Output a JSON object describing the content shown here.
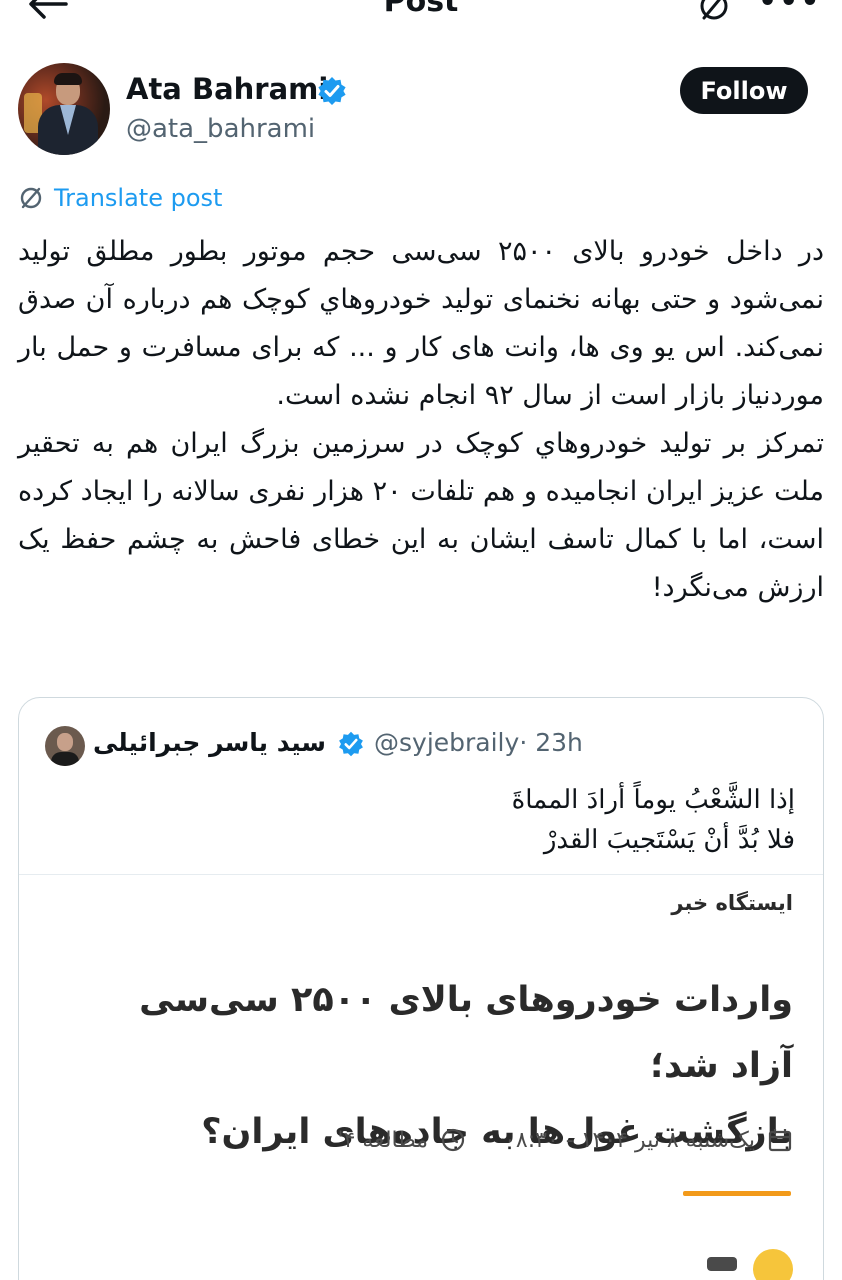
{
  "topbar": {
    "title": "Post",
    "icons": [
      "back-arrow-icon",
      "translate-icon",
      "more-icon"
    ]
  },
  "author": {
    "name": "Ata Bahrami",
    "handle": "@ata_bahrami",
    "verified": true,
    "follow_label": "Follow"
  },
  "translate": {
    "label": "Translate post",
    "icon": "translate-icon"
  },
  "post": {
    "paragraphs": [
      "در داخل خودرو بالای ۲۵۰۰ سی‌سی حجم موتور بطور مطلق تولید نمی‌شود و حتی بهانه نخنمای تولید خودروهاي کوچک هم درباره آن صدق نمی‌کند. اس یو وی ها، وانت های کار و ... که برای مسافرت و حمل بار موردنیاز بازار است از سال ۹۲ انجام نشده است.",
      "تمرکز بر تولید خودروهاي کوچک در سرزمین بزرگ ایران هم به تحقیر ملت عزیز ایران انجامیده و هم تلفات ۲۰ هزار نفری سالانه را ایجاد کرده است، اما با کمال تاسف ایشان به این خطای فاحش به چشم حفظ یک ارزش می‌نگرد!"
    ]
  },
  "quote": {
    "name": "سید یاسر جبرائیلی",
    "handle": "@syjebraily",
    "time": "· 23h",
    "verified": true,
    "lines": [
      "إذا الشَّعْبُ يوماً أرادَ المماةَ",
      "فلا بُدَّ أنْ يَسْتَجيبَ القدرْ"
    ],
    "news": {
      "source": "ایستگاه خبر",
      "headline_lines": [
        "واردات خودروهای بالای ۲۵۰۰ سی‌سی آزاد شد؛",
        "بازگشت غول‌ها به جاده‌های ایران؟"
      ],
      "date": "یک‌شنبه ۸ تیر ۱۴۰۴ - ۰۸:۳۰",
      "read_time": "مطالعه ۴'",
      "accent": "#f29a1a"
    }
  },
  "colors": {
    "link": "#1d9bf0",
    "verified": "#1d9bf0",
    "text": "#0f1419",
    "muted": "#536471",
    "button": "#0f1419"
  }
}
